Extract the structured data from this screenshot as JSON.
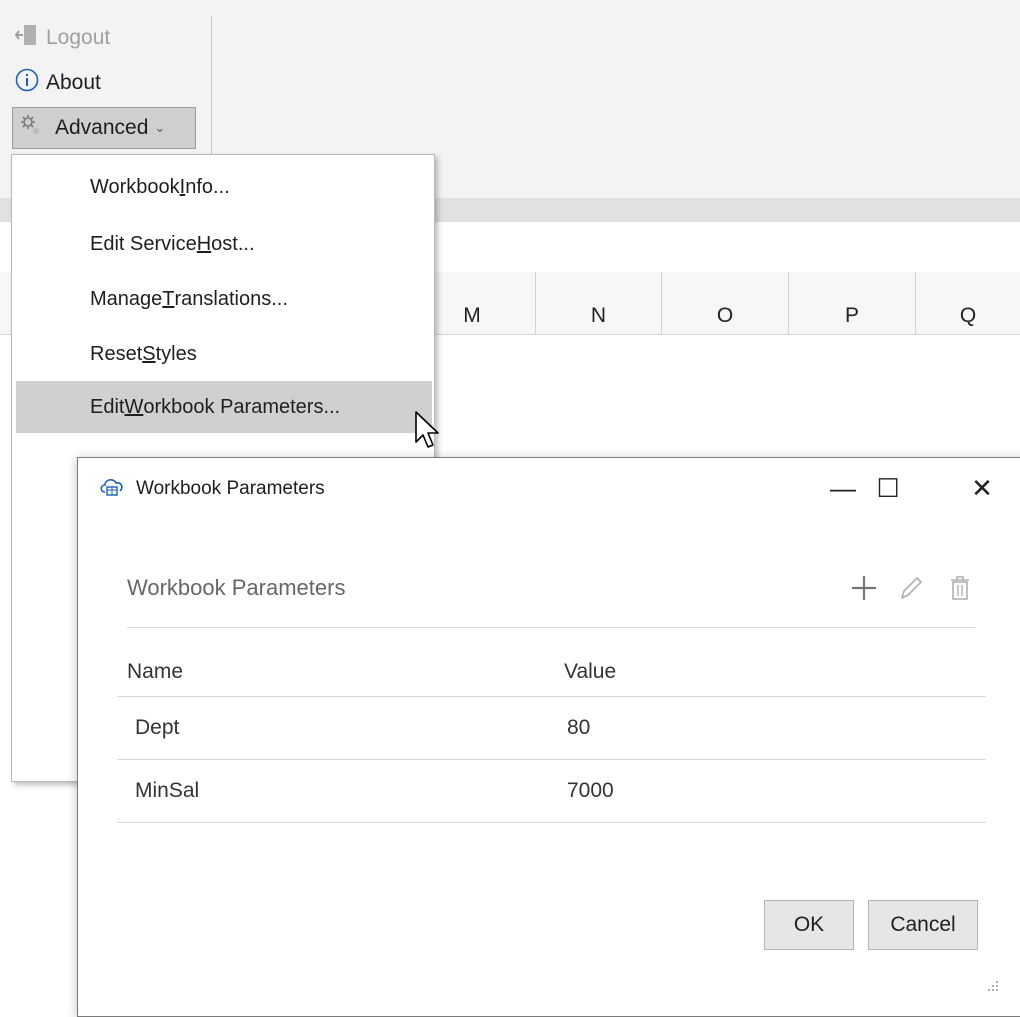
{
  "ribbon": {
    "logout_label": "Logout",
    "about_label": "About",
    "advanced_label": "Advanced",
    "logout_icon": "logout-icon",
    "about_icon": "info-icon",
    "advanced_icon": "gear-icon"
  },
  "columns": [
    "M",
    "N",
    "O",
    "P",
    "Q"
  ],
  "menu": {
    "items": [
      {
        "pre": "Workbook ",
        "u": "I",
        "post": "nfo..."
      },
      {
        "pre": "Edit Service ",
        "u": "H",
        "post": "ost..."
      },
      {
        "pre": "Manage ",
        "u": "T",
        "post": "ranslations..."
      },
      {
        "pre": "Reset ",
        "u": "S",
        "post": "tyles"
      },
      {
        "pre": "Edit ",
        "u": "W",
        "post": "orkbook Parameters..."
      }
    ],
    "highlighted_index": 4
  },
  "dialog": {
    "title": "Workbook Parameters",
    "title_icon": "cloud-table-icon",
    "minimize_glyph": "—",
    "maximize_glyph": "☐",
    "close_glyph": "✕",
    "section_title": "Workbook Parameters",
    "toolbar_icons": [
      "add-icon",
      "edit-icon",
      "delete-icon"
    ],
    "headers": {
      "name": "Name",
      "value": "Value"
    },
    "rows": [
      {
        "name": "Dept",
        "value": "80"
      },
      {
        "name": "MinSal",
        "value": "7000"
      }
    ],
    "ok_label": "OK",
    "cancel_label": "Cancel"
  }
}
